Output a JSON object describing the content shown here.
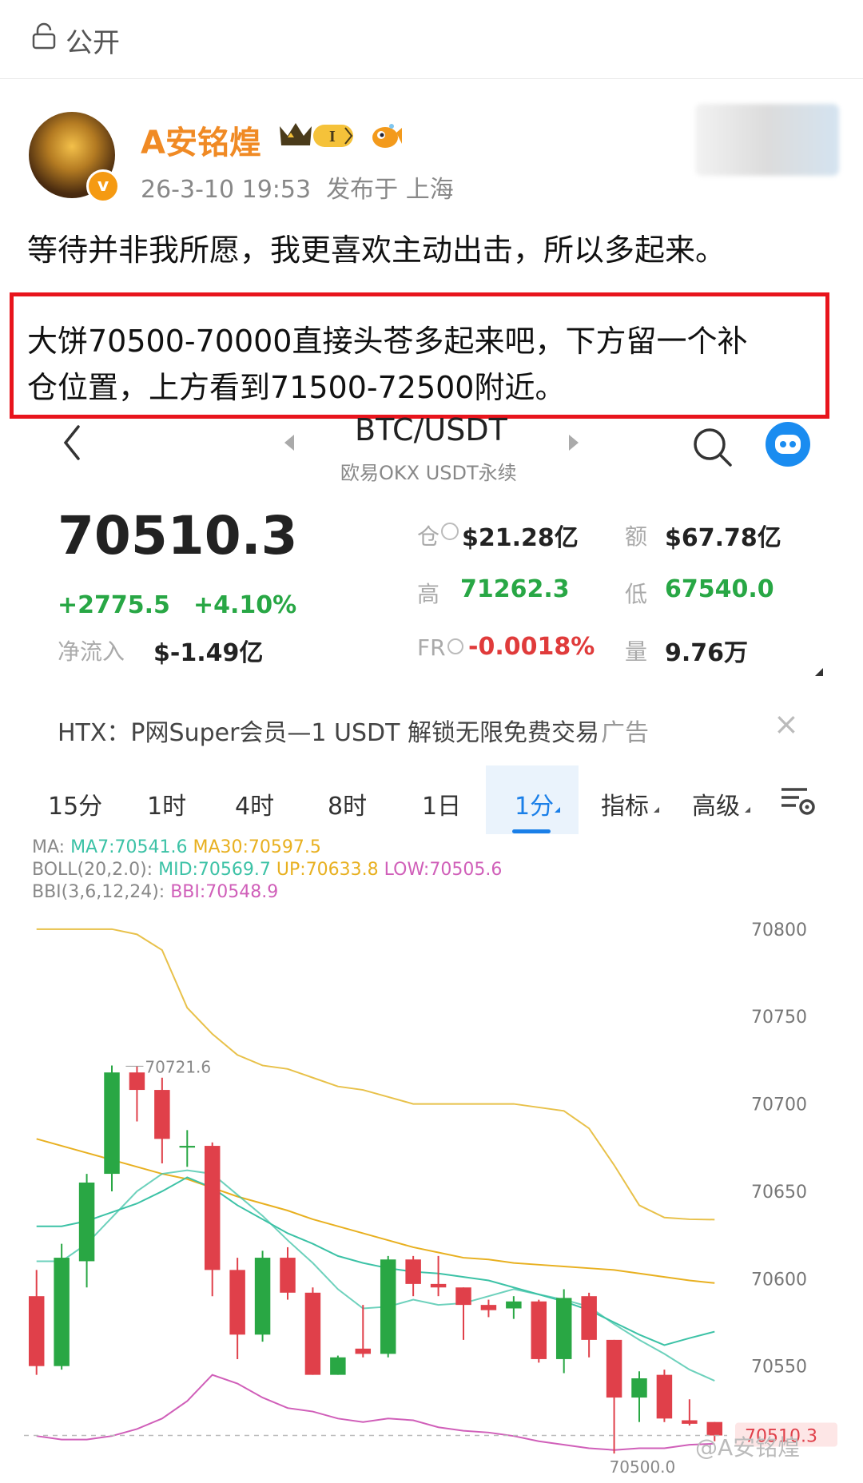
{
  "header": {
    "visibility": "公开"
  },
  "post": {
    "username": "A安铭煌",
    "rank_badge": "I",
    "timestamp": "26-3-10 19:53",
    "location": "发布于 上海",
    "line1": "等待并非我所愿，我更喜欢主动出击，所以多起来。",
    "line2a": "大饼70500-70000直接头苍多起来吧，下方留一个补",
    "line2b": "仓位置，上方看到71500-72500附近。"
  },
  "ticker": {
    "pair": "BTC/USDT",
    "exchange": "欧易OKX USDT永续",
    "price": "70510.3",
    "change_abs": "+2775.5",
    "change_pct": "+4.10%",
    "netflow_label": "净流入",
    "netflow_value": "$-1.49亿",
    "oi_label": "仓",
    "oi_value": "$21.28亿",
    "turnover_label": "额",
    "turnover_value": "$67.78亿",
    "high_label": "高",
    "high_value": "71262.3",
    "low_label": "低",
    "low_value": "67540.0",
    "fr_label": "FR",
    "fr_value": "-0.0018%",
    "vol_label": "量",
    "vol_value": "9.76万"
  },
  "ad": {
    "text": "HTX：P网Super会员—1 USDT 解锁无限免费交易",
    "tag": "广告",
    "close": "×"
  },
  "tabs": [
    "15分",
    "1时",
    "4时",
    "8时",
    "1日",
    "1分",
    "指标",
    "高级"
  ],
  "indicators": {
    "ma_label": "MA:",
    "ma7": "MA7:70541.6",
    "ma30": "MA30:70597.5",
    "boll_label": "BOLL(20,2.0):",
    "boll_mid": "MID:70569.7",
    "boll_up": "UP:70633.8",
    "boll_low": "LOW:70505.6",
    "bbi_label": "BBI(3,6,12,24):",
    "bbi": "BBI:70548.9"
  },
  "colors": {
    "up": "#29a744",
    "down": "#e0404a",
    "ma7": "#e8c14a",
    "ma30": "#e8b020",
    "mid": "#3cc2a6",
    "low": "#d05fb9",
    "accent": "#1a7fe8"
  },
  "chart_data": {
    "type": "candlestick",
    "y_ticks": [
      "70800",
      "70750",
      "70700",
      "70650",
      "70600",
      "70550"
    ],
    "ylim": [
      70495,
      70815
    ],
    "max_label": "70721.6",
    "min_label": "70500.0",
    "last_label": "70510.3",
    "candles": [
      {
        "o": 70590,
        "h": 70605,
        "c": 70550,
        "l": 70545
      },
      {
        "o": 70550,
        "h": 70620,
        "c": 70612,
        "l": 70548
      },
      {
        "o": 70610,
        "h": 70660,
        "c": 70655,
        "l": 70595
      },
      {
        "o": 70660,
        "h": 70722,
        "c": 70718,
        "l": 70650
      },
      {
        "o": 70718,
        "h": 70721.6,
        "c": 70708,
        "l": 70690
      },
      {
        "o": 70708,
        "h": 70715,
        "c": 70680,
        "l": 70666
      },
      {
        "o": 70675,
        "h": 70685,
        "c": 70676,
        "l": 70664
      },
      {
        "o": 70676,
        "h": 70678,
        "c": 70605,
        "l": 70590
      },
      {
        "o": 70605,
        "h": 70612,
        "c": 70568,
        "l": 70554
      },
      {
        "o": 70568,
        "h": 70616,
        "c": 70612,
        "l": 70564
      },
      {
        "o": 70612,
        "h": 70618,
        "c": 70592,
        "l": 70588
      },
      {
        "o": 70592,
        "h": 70595,
        "c": 70545,
        "l": 70545
      },
      {
        "o": 70545,
        "h": 70556,
        "c": 70555,
        "l": 70545
      },
      {
        "o": 70560,
        "h": 70585,
        "c": 70557,
        "l": 70555
      },
      {
        "o": 70557,
        "h": 70613,
        "c": 70611,
        "l": 70555
      },
      {
        "o": 70611,
        "h": 70613,
        "c": 70597,
        "l": 70590
      },
      {
        "o": 70597,
        "h": 70613,
        "c": 70595,
        "l": 70590
      },
      {
        "o": 70595,
        "h": 70592,
        "c": 70585,
        "l": 70565
      },
      {
        "o": 70585,
        "h": 70588,
        "c": 70582,
        "l": 70578
      },
      {
        "o": 70583,
        "h": 70590,
        "c": 70587,
        "l": 70577
      },
      {
        "o": 70587,
        "h": 70588,
        "c": 70554,
        "l": 70552
      },
      {
        "o": 70554,
        "h": 70594,
        "c": 70589,
        "l": 70546
      },
      {
        "o": 70590,
        "h": 70592,
        "c": 70565,
        "l": 70555
      },
      {
        "o": 70565,
        "h": 70565,
        "c": 70532,
        "l": 70500
      },
      {
        "o": 70532,
        "h": 70547,
        "c": 70543,
        "l": 70518
      },
      {
        "o": 70545,
        "h": 70548,
        "c": 70520,
        "l": 70518
      },
      {
        "o": 70519,
        "h": 70531,
        "c": 70517,
        "l": 70516
      },
      {
        "o": 70518,
        "h": 70518,
        "c": 70510.3,
        "l": 70507
      }
    ],
    "series": [
      {
        "name": "UP",
        "values": [
          70800,
          70800,
          70800,
          70800,
          70797,
          70788,
          70755,
          70740,
          70728,
          70722,
          70720,
          70715,
          70710,
          70708,
          70704,
          70700,
          70700,
          70700,
          70700,
          70700,
          70698,
          70696,
          70686,
          70665,
          70642,
          70635,
          70634,
          70633.8
        ]
      },
      {
        "name": "MA30",
        "values": [
          70680,
          70676,
          70672,
          70668,
          70664,
          70660,
          70657,
          70652,
          70647,
          70643,
          70639,
          70634,
          70630,
          70626,
          70622,
          70618,
          70615,
          70612,
          70611,
          70609,
          70608,
          70607,
          70606,
          70605,
          70603,
          70601,
          70599,
          70597.5
        ]
      },
      {
        "name": "MID",
        "values": [
          70630,
          70630,
          70633,
          70638,
          70643,
          70650,
          70658,
          70652,
          70642,
          70634,
          70626,
          70620,
          70613,
          70609,
          70606,
          70604,
          70603,
          70601,
          70599,
          70595,
          70591,
          70587,
          70582,
          70575,
          70568,
          70562,
          70566,
          70569.7
        ]
      },
      {
        "name": "MA7",
        "values": [
          70610,
          70610,
          70620,
          70635,
          70650,
          70660,
          70662,
          70660,
          70648,
          70636,
          70622,
          70609,
          70594,
          70583,
          70584,
          70588,
          70585,
          70586,
          70590,
          70594,
          70591,
          70588,
          70584,
          70574,
          70565,
          70557,
          70548,
          70541.6
        ]
      },
      {
        "name": "LOW",
        "values": [
          70510,
          70508,
          70508,
          70510,
          70514,
          70520,
          70530,
          70545,
          70540,
          70532,
          70526,
          70524,
          70520,
          70518,
          70520,
          70519,
          70515,
          70513,
          70512,
          70510,
          70507,
          70505,
          70503,
          70502,
          70503,
          70503,
          70505,
          70505.6
        ]
      }
    ]
  },
  "watermark": "@A安铭煌"
}
